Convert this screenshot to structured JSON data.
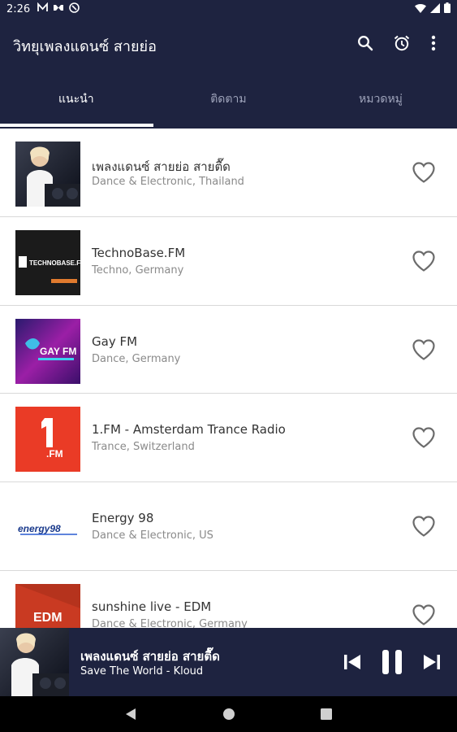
{
  "status_bar": {
    "time": "2:26",
    "left_icons": [
      "M-notification-icon",
      "link-icon",
      "sync-icon"
    ],
    "right_icons": [
      "wifi-icon",
      "signal-icon",
      "battery-icon"
    ]
  },
  "app_bar": {
    "title": "วิทยุเพลงแดนซ์ สายย่อ",
    "actions": [
      "search-icon",
      "alarm-icon",
      "more-vert-icon"
    ]
  },
  "tabs": [
    {
      "label": "แนะนำ",
      "active": true
    },
    {
      "label": "ติดตาม",
      "active": false
    },
    {
      "label": "หมวดหมู่",
      "active": false
    }
  ],
  "stations": [
    {
      "name": "เพลงแดนซ์ สายย่อ สายตื๊ด",
      "meta": "Dance & Electronic, Thailand",
      "logo": "dj-girl-logo",
      "favorite": false
    },
    {
      "name": "TechnoBase.FM",
      "meta": "Techno, Germany",
      "logo": "technobase-logo",
      "logo_text": "TECHNOBASE.FM",
      "favorite": false
    },
    {
      "name": "Gay FM",
      "meta": "Dance, Germany",
      "logo": "gayfm-logo",
      "logo_text": "GAY FM",
      "favorite": false
    },
    {
      "name": "1.FM - Amsterdam Trance Radio",
      "meta": "Trance, Switzerland",
      "logo": "1fm-logo",
      "logo_text": ".FM",
      "favorite": false
    },
    {
      "name": "Energy 98",
      "meta": "Dance & Electronic, US",
      "logo": "energy98-logo",
      "logo_text": "energy98",
      "favorite": false
    },
    {
      "name": "sunshine live - EDM",
      "meta": "Dance & Electronic, Germany",
      "logo": "edm-logo",
      "logo_text": "EDM",
      "favorite": false
    }
  ],
  "now_playing": {
    "station": "เพลงแดนซ์ สายย่อ สายตื๊ด",
    "track": "Save The World - Kloud",
    "controls": [
      "skip-previous-icon",
      "pause-icon",
      "skip-next-icon"
    ]
  },
  "nav_bar": [
    "back-icon",
    "home-icon",
    "recents-icon"
  ],
  "colors": {
    "primary": "#1e2340",
    "text_primary": "#333333",
    "text_secondary": "#8a8a8a",
    "divider": "#d9d9d9",
    "tab_inactive": "#9ea3ba"
  }
}
